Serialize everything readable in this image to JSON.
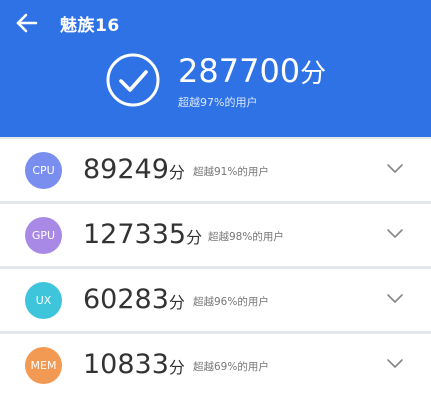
{
  "header": {
    "title": "魅族16",
    "total_score": "287700",
    "unit": "分",
    "rank_text": "超越97%的用户",
    "background_color": "#2f72e6"
  },
  "rows": [
    {
      "badge": "CPU",
      "score": "89249",
      "unit": "分",
      "rank_text": "超越91%的用户",
      "badge_color": "#7a8ef0"
    },
    {
      "badge": "GPU",
      "score": "127335",
      "unit": "分",
      "rank_text": "超越98%的用户",
      "badge_color": "#a88ae6"
    },
    {
      "badge": "UX",
      "score": "60283",
      "unit": "分",
      "rank_text": "超越96%的用户",
      "badge_color": "#3ec5dc"
    },
    {
      "badge": "MEM",
      "score": "10833",
      "unit": "分",
      "rank_text": "超越69%的用户",
      "badge_color": "#f29a53"
    }
  ],
  "icons": {
    "back": "arrow-left-icon",
    "check": "check-circle-icon",
    "expand": "chevron-down-icon"
  }
}
